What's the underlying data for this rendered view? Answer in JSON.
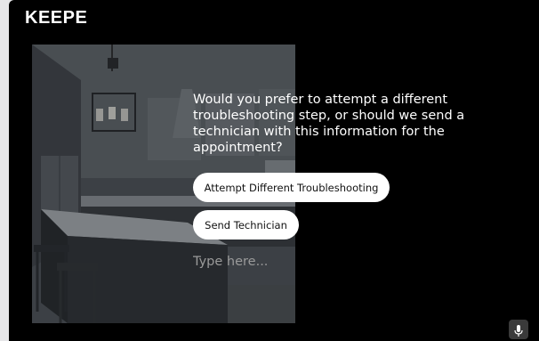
{
  "brand": {
    "logo_text": "KEEPE"
  },
  "chat": {
    "question": "Would you prefer to attempt a different troubleshooting step, or should we send a technician with this information for the appointment?",
    "options": [
      {
        "label": "Attempt Different Troubleshooting"
      },
      {
        "label": "Send Technician"
      }
    ]
  },
  "input": {
    "placeholder": "Type here..."
  },
  "icons": {
    "mic": "microphone-icon"
  },
  "colors": {
    "background": "#000000",
    "button_bg": "#ffffff",
    "text": "#ffffff",
    "placeholder": "#9a9a9a"
  }
}
